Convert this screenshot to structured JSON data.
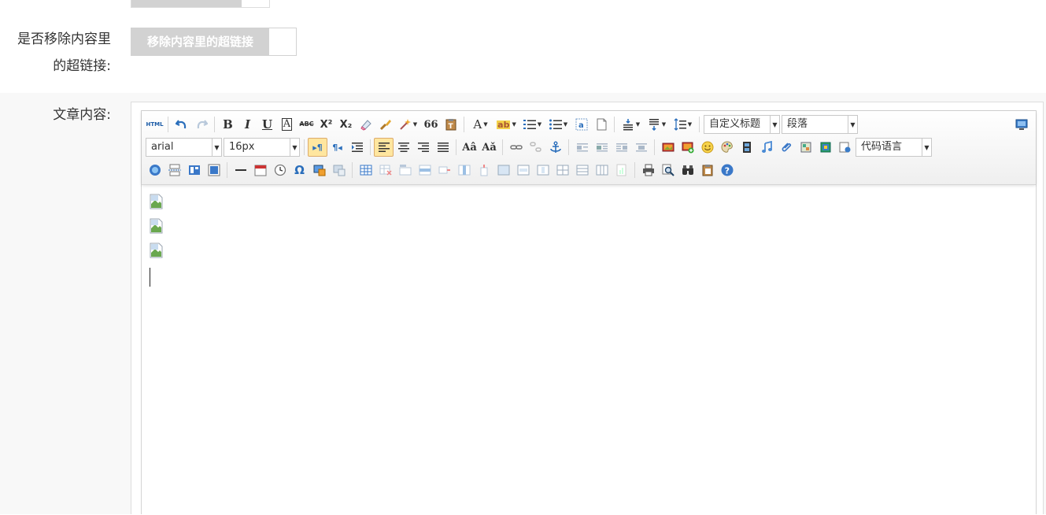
{
  "form": {
    "remove_links": {
      "label_line1": "是否移除内容里",
      "label_line2": "的超链接:",
      "switch_text": "移除内容里的超链接"
    },
    "content": {
      "label": "文章内容:"
    }
  },
  "editor": {
    "toolbar": {
      "row1": {
        "html_label": "HTML",
        "bold": "B",
        "italic": "I",
        "underline": "U",
        "font_border": "A",
        "strike": "ABC",
        "superscript": "X²",
        "subscript": "X₂",
        "blockquote": "66",
        "forecolor": "A",
        "backcolor": "ab",
        "custom_style_value": "自定义标题",
        "paragraph_value": "段落"
      },
      "row2": {
        "font_family_value": "arial",
        "font_size_value": "16px",
        "code_language_value": "代码语言"
      },
      "row3": {
        "special_chars": "Ω"
      }
    },
    "content": {
      "image_count": 3
    }
  },
  "colors": {
    "active_button_bg": "#ffe69f",
    "switch_gray": "#d2d2d2",
    "band_bg": "#f8f8f8"
  }
}
